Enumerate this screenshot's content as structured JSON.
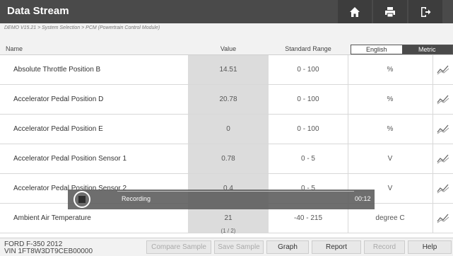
{
  "titlebar": {
    "title": "Data Stream",
    "icons": [
      "home-icon",
      "print-icon",
      "exit-icon"
    ]
  },
  "breadcrumb": "DEMO V15.21 > System Selection > PCM (Powertrain Control Module)",
  "table": {
    "headers": {
      "name": "Name",
      "value": "Value",
      "range": "Standard Range"
    },
    "unit_toggle": {
      "english": "English",
      "metric": "Metric",
      "selected": "Metric"
    },
    "rows": [
      {
        "name": "Absolute Throttle Position B",
        "value": "14.51",
        "range": "0 - 100",
        "unit": "%"
      },
      {
        "name": "Accelerator Pedal Position D",
        "value": "20.78",
        "range": "0 - 100",
        "unit": "%"
      },
      {
        "name": "Accelerator Pedal Position E",
        "value": "0",
        "range": "0 - 100",
        "unit": "%"
      },
      {
        "name": "Accelerator Pedal Position Sensor 1",
        "value": "0.78",
        "range": "0 - 5",
        "unit": "V"
      },
      {
        "name": "Accelerator Pedal Position Sensor 2",
        "value": "0.4",
        "range": "0 - 5",
        "unit": "V"
      },
      {
        "name": "Ambient Air Temperature",
        "value": "21",
        "range": "-40 - 215",
        "unit": "degree C"
      }
    ],
    "page_indicator": "(1 / 2)"
  },
  "recording": {
    "label": "Recording",
    "time": "00:12"
  },
  "footer": {
    "vehicle_line1": "FORD F-350 2012",
    "vehicle_line2": "VIN 1FT8W3DT9CEB00000",
    "buttons": {
      "compare_sample": "Compare Sample",
      "save_sample": "Save Sample",
      "graph": "Graph",
      "report": "Report",
      "record": "Record",
      "help": "Help"
    }
  },
  "colors": {
    "titlebar": "#4a4a4a",
    "value_column": "#dcdcdc",
    "recording_overlay": "#5a5a5a"
  }
}
